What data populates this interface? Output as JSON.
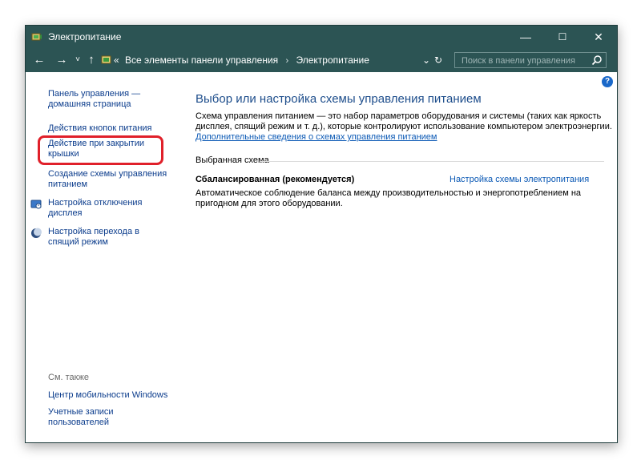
{
  "window": {
    "title": "Электропитание",
    "controls": {
      "minimize": "—",
      "maximize": "☐",
      "close": "✕"
    }
  },
  "address": {
    "back": "←",
    "forward": "→",
    "recent": "˅",
    "up": "↑",
    "overflow": "«",
    "crumbs": [
      "Все элементы панели управления",
      "Электропитание"
    ],
    "separator": "›",
    "dropdown": "⌄",
    "refresh": "↻",
    "search_placeholder": "Поиск в панели управления"
  },
  "sidebar": {
    "items": [
      {
        "label": "Панель управления — домашняя страница"
      },
      {
        "label": "Действия кнопок питания"
      },
      {
        "label": "Действие при закрытии крышки"
      },
      {
        "label": "Создание схемы управления питанием"
      },
      {
        "label": "Настройка отключения дисплея"
      },
      {
        "label": "Настройка перехода в спящий режим"
      }
    ],
    "see_also": {
      "heading": "См. также",
      "items": [
        {
          "label": "Центр мобильности Windows"
        },
        {
          "label": "Учетные записи пользователей"
        }
      ]
    }
  },
  "main": {
    "help": "?",
    "title": "Выбор или настройка схемы управления питанием",
    "description": "Схема управления питанием — это набор параметров оборудования и системы (таких как яркость дисплея, спящий режим и т. д.), которые контролируют использование компьютером электроэнергии.",
    "description_link": "Дополнительные сведения о схемах управления питанием",
    "group_label": "Выбранная схема",
    "plan": {
      "name": "Сбалансированная (рекомендуется)",
      "settings_link": "Настройка схемы электропитания",
      "description": "Автоматическое соблюдение баланса между производительностью и энергопотреблением на пригодном для этого оборудовании."
    }
  },
  "colors": {
    "titlebar": "#2c5454",
    "link": "#0b3c8c",
    "title_text": "#1e4e8c",
    "highlight": "#e0202a"
  }
}
